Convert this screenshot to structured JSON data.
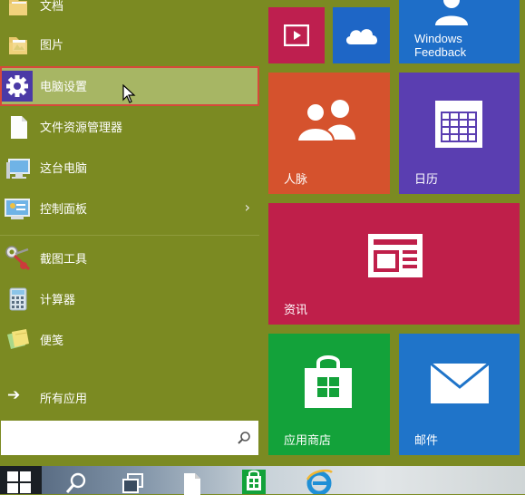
{
  "start_menu": {
    "items": [
      {
        "label": "文档",
        "icon": "documents-folder-icon"
      },
      {
        "label": "图片",
        "icon": "pictures-folder-icon"
      },
      {
        "label": "电脑设置",
        "icon": "gear-icon",
        "selected": true
      },
      {
        "label": "文件资源管理器",
        "icon": "file-icon"
      },
      {
        "label": "这台电脑",
        "icon": "computer-icon"
      },
      {
        "label": "控制面板",
        "icon": "control-panel-icon",
        "chevron": "›"
      },
      {
        "label": "截图工具",
        "icon": "scissors-icon"
      },
      {
        "label": "计算器",
        "icon": "calculator-icon"
      },
      {
        "label": "便笺",
        "icon": "sticky-notes-icon"
      }
    ],
    "all_apps": {
      "label": "所有应用",
      "arrow": "➔"
    },
    "search": {
      "value": "",
      "icon": "search-icon"
    }
  },
  "tiles": {
    "video": {
      "icon": "video-icon"
    },
    "onedrive": {
      "icon": "cloud-icon"
    },
    "feedback": {
      "line1": "Windows",
      "line2": "Feedback",
      "icon": "feedback-person-icon"
    },
    "people": {
      "label": "人脉",
      "icon": "people-icon"
    },
    "calendar": {
      "label": "日历",
      "icon": "calendar-icon"
    },
    "news": {
      "label": "资讯",
      "icon": "news-icon"
    },
    "store": {
      "label": "应用商店",
      "icon": "store-bag-icon"
    },
    "mail": {
      "label": "邮件",
      "icon": "envelope-icon"
    }
  },
  "colors": {
    "background": "#7b8a22",
    "selection": "#a7b664",
    "selection_border": "#d6493a",
    "video": "#be1f4f",
    "onedrive": "#1e66c6",
    "feedback": "#1e6ec8",
    "people": "#d5522d",
    "calendar": "#5a3eb1",
    "news": "#bf1f4a",
    "store": "#13a23a",
    "mail": "#1f74c9"
  },
  "taskbar": {
    "buttons": [
      "windows-logo-icon",
      "search-icon",
      "task-view-icon",
      "file-explorer-icon",
      "store-icon",
      "ie-icon"
    ]
  }
}
